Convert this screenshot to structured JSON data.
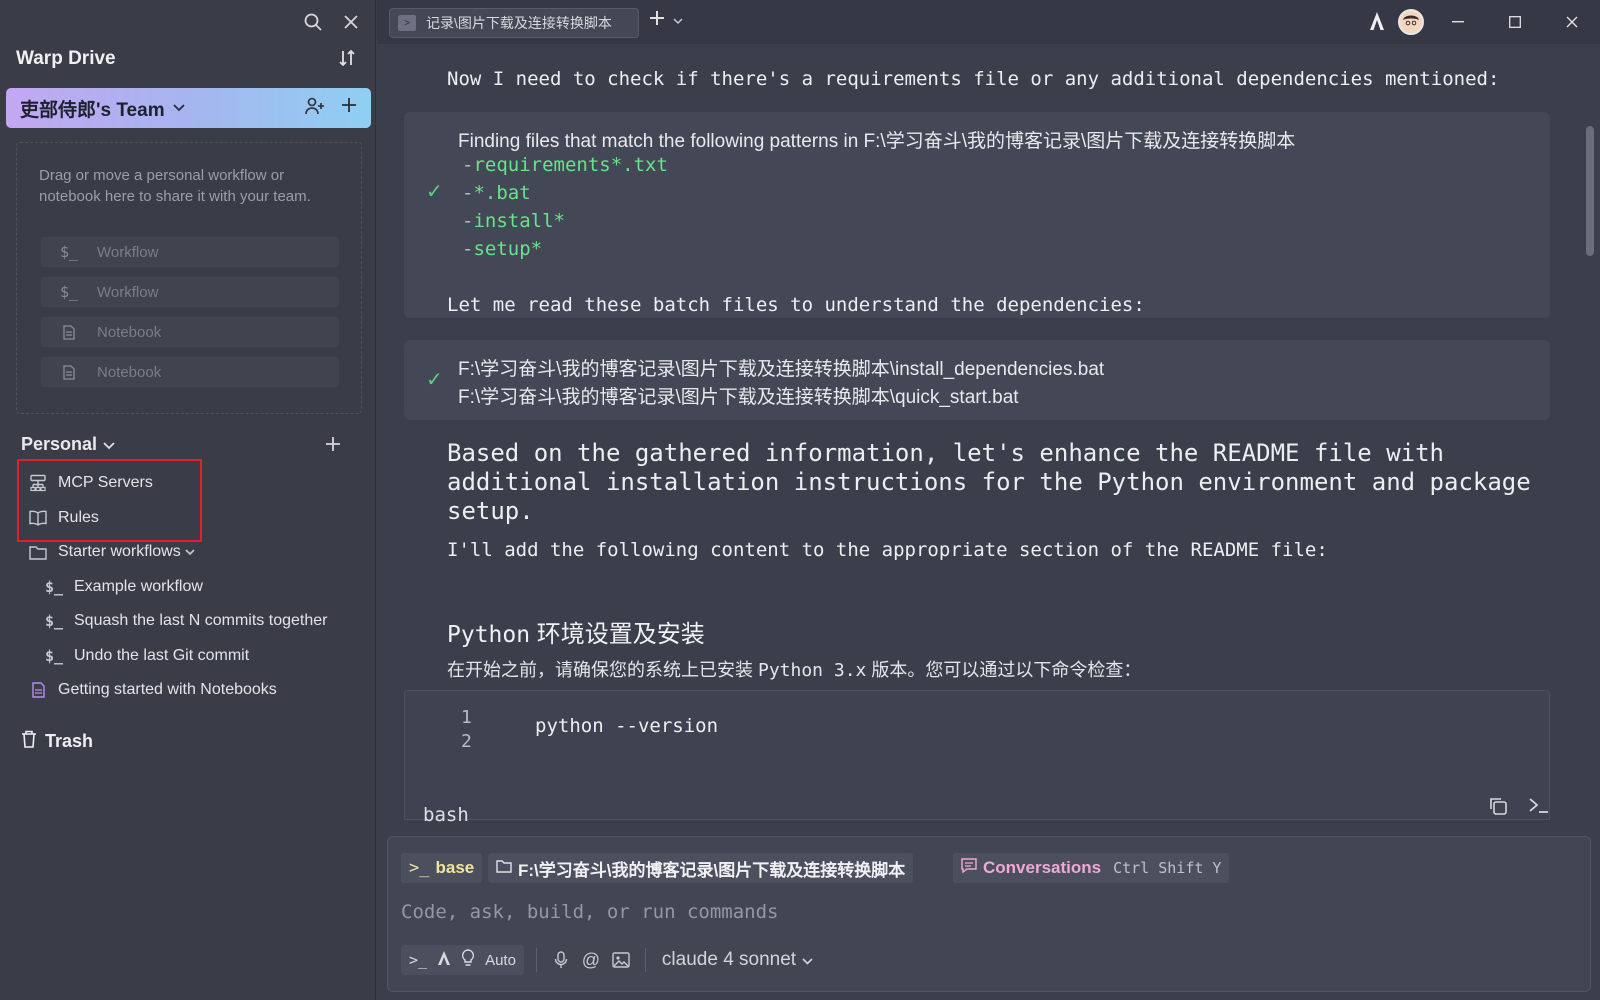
{
  "sidebar": {
    "title": "Warp Drive",
    "team": {
      "name": "吏部侍郎's Team"
    },
    "dropzone": {
      "hint": "Drag or move a personal workflow or notebook here to share it with your team.",
      "placeholders": [
        {
          "label": "Workflow",
          "icon": "workflow-icon"
        },
        {
          "label": "Workflow",
          "icon": "workflow-icon"
        },
        {
          "label": "Notebook",
          "icon": "notebook-icon"
        },
        {
          "label": "Notebook",
          "icon": "notebook-icon"
        }
      ]
    },
    "personal": {
      "label": "Personal",
      "items": [
        {
          "label": "MCP Servers",
          "icon": "mcp-servers-icon"
        },
        {
          "label": "Rules",
          "icon": "book-icon"
        },
        {
          "label": "Starter workflows",
          "icon": "folder-icon"
        },
        {
          "label": "Example workflow",
          "icon": "workflow-icon"
        },
        {
          "label": "Squash the last N commits together",
          "icon": "workflow-icon"
        },
        {
          "label": "Undo the last Git commit",
          "icon": "workflow-icon"
        },
        {
          "label": "Getting started with Notebooks",
          "icon": "notebook-icon"
        }
      ]
    },
    "trash_label": "Trash",
    "workflow_glyph": "$_"
  },
  "titlebar": {
    "tab_label": "记录\\图片下载及连接转换脚本"
  },
  "conversation": {
    "msg1": "Now I need to check if there's a requirements file or any additional dependencies mentioned:",
    "find_block": {
      "header": "Finding files that match the following patterns in F:\\学习奋斗\\我的博客记录\\图片下载及连接转换脚本",
      "patterns": [
        "requirements*.txt",
        "*.bat",
        "install*",
        "setup*"
      ]
    },
    "msg2": "Let me read these batch files to understand the dependencies:",
    "read_block": {
      "files": [
        "F:\\学习奋斗\\我的博客记录\\图片下载及连接转换脚本\\install_dependencies.bat",
        "F:\\学习奋斗\\我的博客记录\\图片下载及连接转换脚本\\quick_start.bat"
      ]
    },
    "msg3_line1": "Based on the gathered information, let's enhance the README file with",
    "msg3_line2": "additional installation instructions for the Python environment and package",
    "msg3_line3": "setup.",
    "msg4": "I'll add the following content to the appropriate section of the README file:",
    "heading_en": "Python",
    "heading_zh": " 环境设置及安装",
    "para_a": "在开始之前，请确保您的系统上已安装 ",
    "para_b": "Python 3.x",
    "para_c": " 版本。您可以通过以下命令检查：",
    "code": {
      "line_numbers": [
        "1",
        "2"
      ],
      "content": "python --version",
      "language": "bash"
    }
  },
  "input": {
    "env": "base",
    "path": "F:\\学习奋斗\\我的博客记录\\图片下载及连接转换脚本",
    "conversations_label": "Conversations",
    "conversations_shortcut": "Ctrl Shift Y",
    "placeholder": "Code, ask, build, or run commands",
    "mode": "Auto",
    "model": "claude 4 sonnet"
  },
  "colors": {
    "accent_green": "#66e48a",
    "check_green": "#5ad17d",
    "highlight_red": "#e0202a",
    "workflow_red": "#e2545b",
    "env_yellow": "#f1e39b",
    "conv_pink": "#f0a8d4"
  }
}
